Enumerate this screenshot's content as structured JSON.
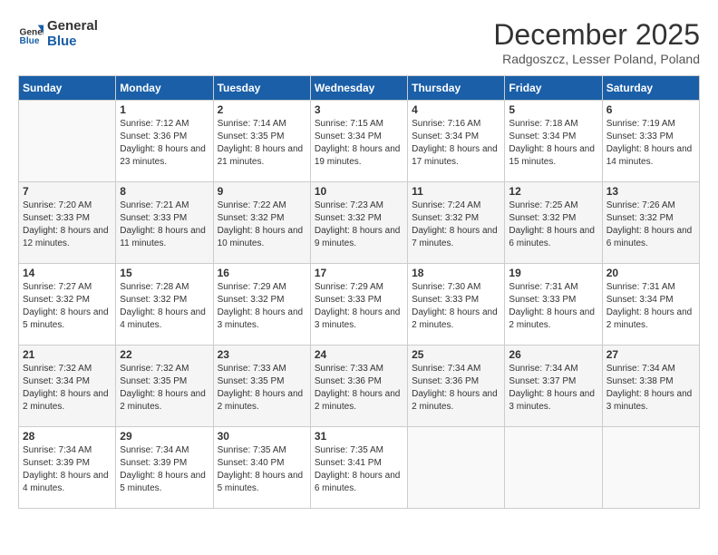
{
  "header": {
    "logo_line1": "General",
    "logo_line2": "Blue",
    "month_title": "December 2025",
    "location": "Radgoszcz, Lesser Poland, Poland"
  },
  "weekdays": [
    "Sunday",
    "Monday",
    "Tuesday",
    "Wednesday",
    "Thursday",
    "Friday",
    "Saturday"
  ],
  "days": [
    {
      "num": "",
      "sunrise": "",
      "sunset": "",
      "daylight": "",
      "empty": true
    },
    {
      "num": "1",
      "sunrise": "Sunrise: 7:12 AM",
      "sunset": "Sunset: 3:36 PM",
      "daylight": "Daylight: 8 hours and 23 minutes."
    },
    {
      "num": "2",
      "sunrise": "Sunrise: 7:14 AM",
      "sunset": "Sunset: 3:35 PM",
      "daylight": "Daylight: 8 hours and 21 minutes."
    },
    {
      "num": "3",
      "sunrise": "Sunrise: 7:15 AM",
      "sunset": "Sunset: 3:34 PM",
      "daylight": "Daylight: 8 hours and 19 minutes."
    },
    {
      "num": "4",
      "sunrise": "Sunrise: 7:16 AM",
      "sunset": "Sunset: 3:34 PM",
      "daylight": "Daylight: 8 hours and 17 minutes."
    },
    {
      "num": "5",
      "sunrise": "Sunrise: 7:18 AM",
      "sunset": "Sunset: 3:34 PM",
      "daylight": "Daylight: 8 hours and 15 minutes."
    },
    {
      "num": "6",
      "sunrise": "Sunrise: 7:19 AM",
      "sunset": "Sunset: 3:33 PM",
      "daylight": "Daylight: 8 hours and 14 minutes."
    },
    {
      "num": "7",
      "sunrise": "Sunrise: 7:20 AM",
      "sunset": "Sunset: 3:33 PM",
      "daylight": "Daylight: 8 hours and 12 minutes."
    },
    {
      "num": "8",
      "sunrise": "Sunrise: 7:21 AM",
      "sunset": "Sunset: 3:33 PM",
      "daylight": "Daylight: 8 hours and 11 minutes."
    },
    {
      "num": "9",
      "sunrise": "Sunrise: 7:22 AM",
      "sunset": "Sunset: 3:32 PM",
      "daylight": "Daylight: 8 hours and 10 minutes."
    },
    {
      "num": "10",
      "sunrise": "Sunrise: 7:23 AM",
      "sunset": "Sunset: 3:32 PM",
      "daylight": "Daylight: 8 hours and 9 minutes."
    },
    {
      "num": "11",
      "sunrise": "Sunrise: 7:24 AM",
      "sunset": "Sunset: 3:32 PM",
      "daylight": "Daylight: 8 hours and 7 minutes."
    },
    {
      "num": "12",
      "sunrise": "Sunrise: 7:25 AM",
      "sunset": "Sunset: 3:32 PM",
      "daylight": "Daylight: 8 hours and 6 minutes."
    },
    {
      "num": "13",
      "sunrise": "Sunrise: 7:26 AM",
      "sunset": "Sunset: 3:32 PM",
      "daylight": "Daylight: 8 hours and 6 minutes."
    },
    {
      "num": "14",
      "sunrise": "Sunrise: 7:27 AM",
      "sunset": "Sunset: 3:32 PM",
      "daylight": "Daylight: 8 hours and 5 minutes."
    },
    {
      "num": "15",
      "sunrise": "Sunrise: 7:28 AM",
      "sunset": "Sunset: 3:32 PM",
      "daylight": "Daylight: 8 hours and 4 minutes."
    },
    {
      "num": "16",
      "sunrise": "Sunrise: 7:29 AM",
      "sunset": "Sunset: 3:32 PM",
      "daylight": "Daylight: 8 hours and 3 minutes."
    },
    {
      "num": "17",
      "sunrise": "Sunrise: 7:29 AM",
      "sunset": "Sunset: 3:33 PM",
      "daylight": "Daylight: 8 hours and 3 minutes."
    },
    {
      "num": "18",
      "sunrise": "Sunrise: 7:30 AM",
      "sunset": "Sunset: 3:33 PM",
      "daylight": "Daylight: 8 hours and 2 minutes."
    },
    {
      "num": "19",
      "sunrise": "Sunrise: 7:31 AM",
      "sunset": "Sunset: 3:33 PM",
      "daylight": "Daylight: 8 hours and 2 minutes."
    },
    {
      "num": "20",
      "sunrise": "Sunrise: 7:31 AM",
      "sunset": "Sunset: 3:34 PM",
      "daylight": "Daylight: 8 hours and 2 minutes."
    },
    {
      "num": "21",
      "sunrise": "Sunrise: 7:32 AM",
      "sunset": "Sunset: 3:34 PM",
      "daylight": "Daylight: 8 hours and 2 minutes."
    },
    {
      "num": "22",
      "sunrise": "Sunrise: 7:32 AM",
      "sunset": "Sunset: 3:35 PM",
      "daylight": "Daylight: 8 hours and 2 minutes."
    },
    {
      "num": "23",
      "sunrise": "Sunrise: 7:33 AM",
      "sunset": "Sunset: 3:35 PM",
      "daylight": "Daylight: 8 hours and 2 minutes."
    },
    {
      "num": "24",
      "sunrise": "Sunrise: 7:33 AM",
      "sunset": "Sunset: 3:36 PM",
      "daylight": "Daylight: 8 hours and 2 minutes."
    },
    {
      "num": "25",
      "sunrise": "Sunrise: 7:34 AM",
      "sunset": "Sunset: 3:36 PM",
      "daylight": "Daylight: 8 hours and 2 minutes."
    },
    {
      "num": "26",
      "sunrise": "Sunrise: 7:34 AM",
      "sunset": "Sunset: 3:37 PM",
      "daylight": "Daylight: 8 hours and 3 minutes."
    },
    {
      "num": "27",
      "sunrise": "Sunrise: 7:34 AM",
      "sunset": "Sunset: 3:38 PM",
      "daylight": "Daylight: 8 hours and 3 minutes."
    },
    {
      "num": "28",
      "sunrise": "Sunrise: 7:34 AM",
      "sunset": "Sunset: 3:39 PM",
      "daylight": "Daylight: 8 hours and 4 minutes."
    },
    {
      "num": "29",
      "sunrise": "Sunrise: 7:34 AM",
      "sunset": "Sunset: 3:39 PM",
      "daylight": "Daylight: 8 hours and 5 minutes."
    },
    {
      "num": "30",
      "sunrise": "Sunrise: 7:35 AM",
      "sunset": "Sunset: 3:40 PM",
      "daylight": "Daylight: 8 hours and 5 minutes."
    },
    {
      "num": "31",
      "sunrise": "Sunrise: 7:35 AM",
      "sunset": "Sunset: 3:41 PM",
      "daylight": "Daylight: 8 hours and 6 minutes."
    },
    {
      "num": "",
      "sunrise": "",
      "sunset": "",
      "daylight": "",
      "empty": true
    },
    {
      "num": "",
      "sunrise": "",
      "sunset": "",
      "daylight": "",
      "empty": true
    },
    {
      "num": "",
      "sunrise": "",
      "sunset": "",
      "daylight": "",
      "empty": true
    }
  ]
}
